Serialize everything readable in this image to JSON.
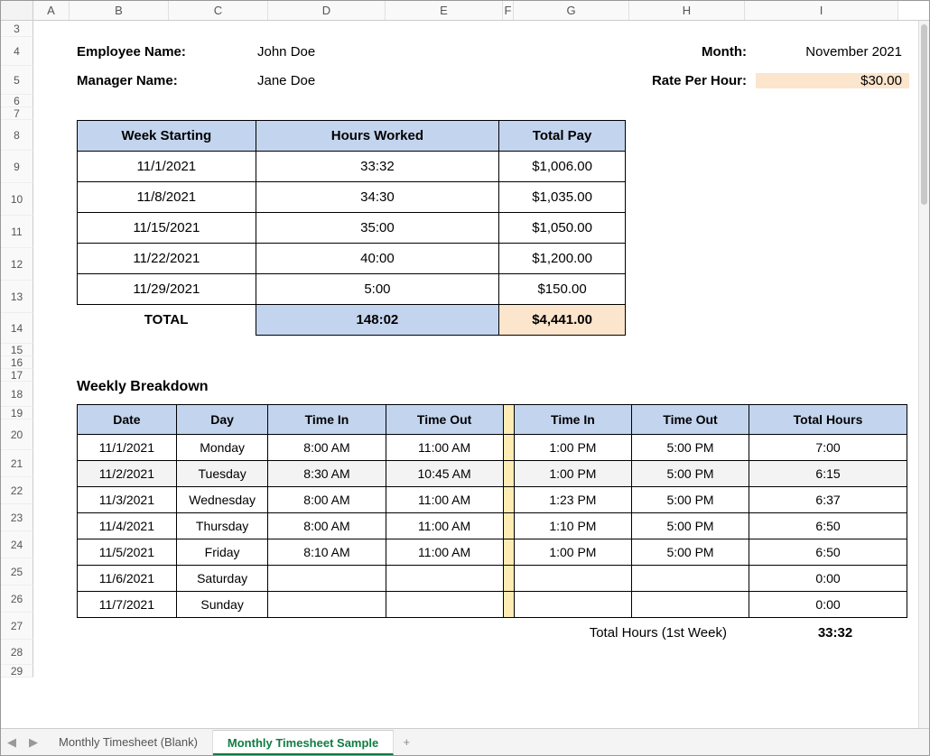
{
  "columns": [
    "A",
    "B",
    "C",
    "D",
    "E",
    "F",
    "G",
    "H",
    "I"
  ],
  "rows": {
    "heights": [
      0,
      0,
      18,
      32,
      32,
      14,
      14,
      34,
      36,
      36,
      36,
      36,
      36,
      34,
      14,
      14,
      14,
      28,
      14,
      34,
      30,
      30,
      30,
      30,
      30,
      30,
      30,
      28,
      14
    ],
    "labels": [
      "3",
      "4",
      "5",
      "6",
      "7",
      "8",
      "9",
      "10",
      "11",
      "12",
      "13",
      "14",
      "15",
      "16",
      "17",
      "18",
      "19",
      "20",
      "21",
      "22",
      "23",
      "24",
      "25",
      "26",
      "27",
      "28",
      "29"
    ]
  },
  "info": {
    "employee_label": "Employee Name:",
    "employee_value": "John Doe",
    "manager_label": "Manager Name:",
    "manager_value": "Jane Doe",
    "month_label": "Month:",
    "month_value": "November 2021",
    "rate_label": "Rate Per Hour:",
    "rate_value": "$30.00"
  },
  "summary": {
    "headers": {
      "week_starting": "Week Starting",
      "hours_worked": "Hours Worked",
      "total_pay": "Total Pay"
    },
    "rows": [
      {
        "week": "11/1/2021",
        "hours": "33:32",
        "pay": "$1,006.00"
      },
      {
        "week": "11/8/2021",
        "hours": "34:30",
        "pay": "$1,035.00"
      },
      {
        "week": "11/15/2021",
        "hours": "35:00",
        "pay": "$1,050.00"
      },
      {
        "week": "11/22/2021",
        "hours": "40:00",
        "pay": "$1,200.00"
      },
      {
        "week": "11/29/2021",
        "hours": "5:00",
        "pay": "$150.00"
      }
    ],
    "total_label": "TOTAL",
    "total_hours": "148:02",
    "total_pay": "$4,441.00"
  },
  "breakdown": {
    "title": "Weekly Breakdown",
    "headers": {
      "date": "Date",
      "day": "Day",
      "time_in": "Time In",
      "time_out": "Time Out",
      "time_in2": "Time In",
      "time_out2": "Time Out",
      "total_hours": "Total Hours"
    },
    "rows": [
      {
        "date": "11/1/2021",
        "day": "Monday",
        "ti": "8:00 AM",
        "to": "11:00 AM",
        "ti2": "1:00 PM",
        "to2": "5:00 PM",
        "th": "7:00",
        "gray": false
      },
      {
        "date": "11/2/2021",
        "day": "Tuesday",
        "ti": "8:30 AM",
        "to": "10:45 AM",
        "ti2": "1:00 PM",
        "to2": "5:00 PM",
        "th": "6:15",
        "gray": true
      },
      {
        "date": "11/3/2021",
        "day": "Wednesday",
        "ti": "8:00 AM",
        "to": "11:00 AM",
        "ti2": "1:23 PM",
        "to2": "5:00 PM",
        "th": "6:37",
        "gray": false
      },
      {
        "date": "11/4/2021",
        "day": "Thursday",
        "ti": "8:00 AM",
        "to": "11:00 AM",
        "ti2": "1:10 PM",
        "to2": "5:00 PM",
        "th": "6:50",
        "gray": false
      },
      {
        "date": "11/5/2021",
        "day": "Friday",
        "ti": "8:10 AM",
        "to": "11:00 AM",
        "ti2": "1:00 PM",
        "to2": "5:00 PM",
        "th": "6:50",
        "gray": false
      },
      {
        "date": "11/6/2021",
        "day": "Saturday",
        "ti": "",
        "to": "",
        "ti2": "",
        "to2": "",
        "th": "0:00",
        "gray": false
      },
      {
        "date": "11/7/2021",
        "day": "Sunday",
        "ti": "",
        "to": "",
        "ti2": "",
        "to2": "",
        "th": "0:00",
        "gray": false
      }
    ],
    "footer_label": "Total Hours (1st Week)",
    "footer_value": "33:32"
  },
  "tabs": {
    "items": [
      {
        "label": "Monthly Timesheet (Blank)",
        "active": false
      },
      {
        "label": "Monthly Timesheet Sample",
        "active": true
      }
    ]
  }
}
